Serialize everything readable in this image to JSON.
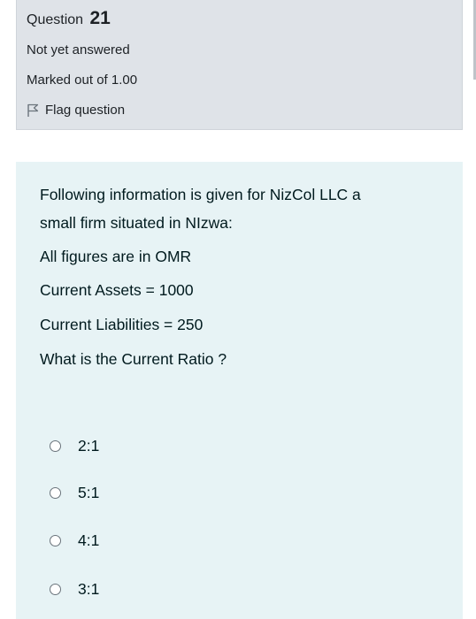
{
  "info": {
    "question_label": "Question",
    "question_number": "21",
    "state": "Not yet answered",
    "grade": "Marked out of 1.00",
    "flag_label": "Flag question"
  },
  "question": {
    "text_lines": [
      "Following information is given for NizCol LLC a",
      "small firm situated in NIzwa:",
      "All figures are in OMR",
      "Current Assets = 1000",
      "Current Liabilities = 250",
      "What is  the Current Ratio  ?"
    ],
    "answers": [
      "2:1",
      "5:1",
      "4:1",
      "3:1"
    ]
  },
  "colors": {
    "info_background": "#dfe3e8",
    "content_background": "#e7f3f5",
    "text": "#001a1e"
  }
}
